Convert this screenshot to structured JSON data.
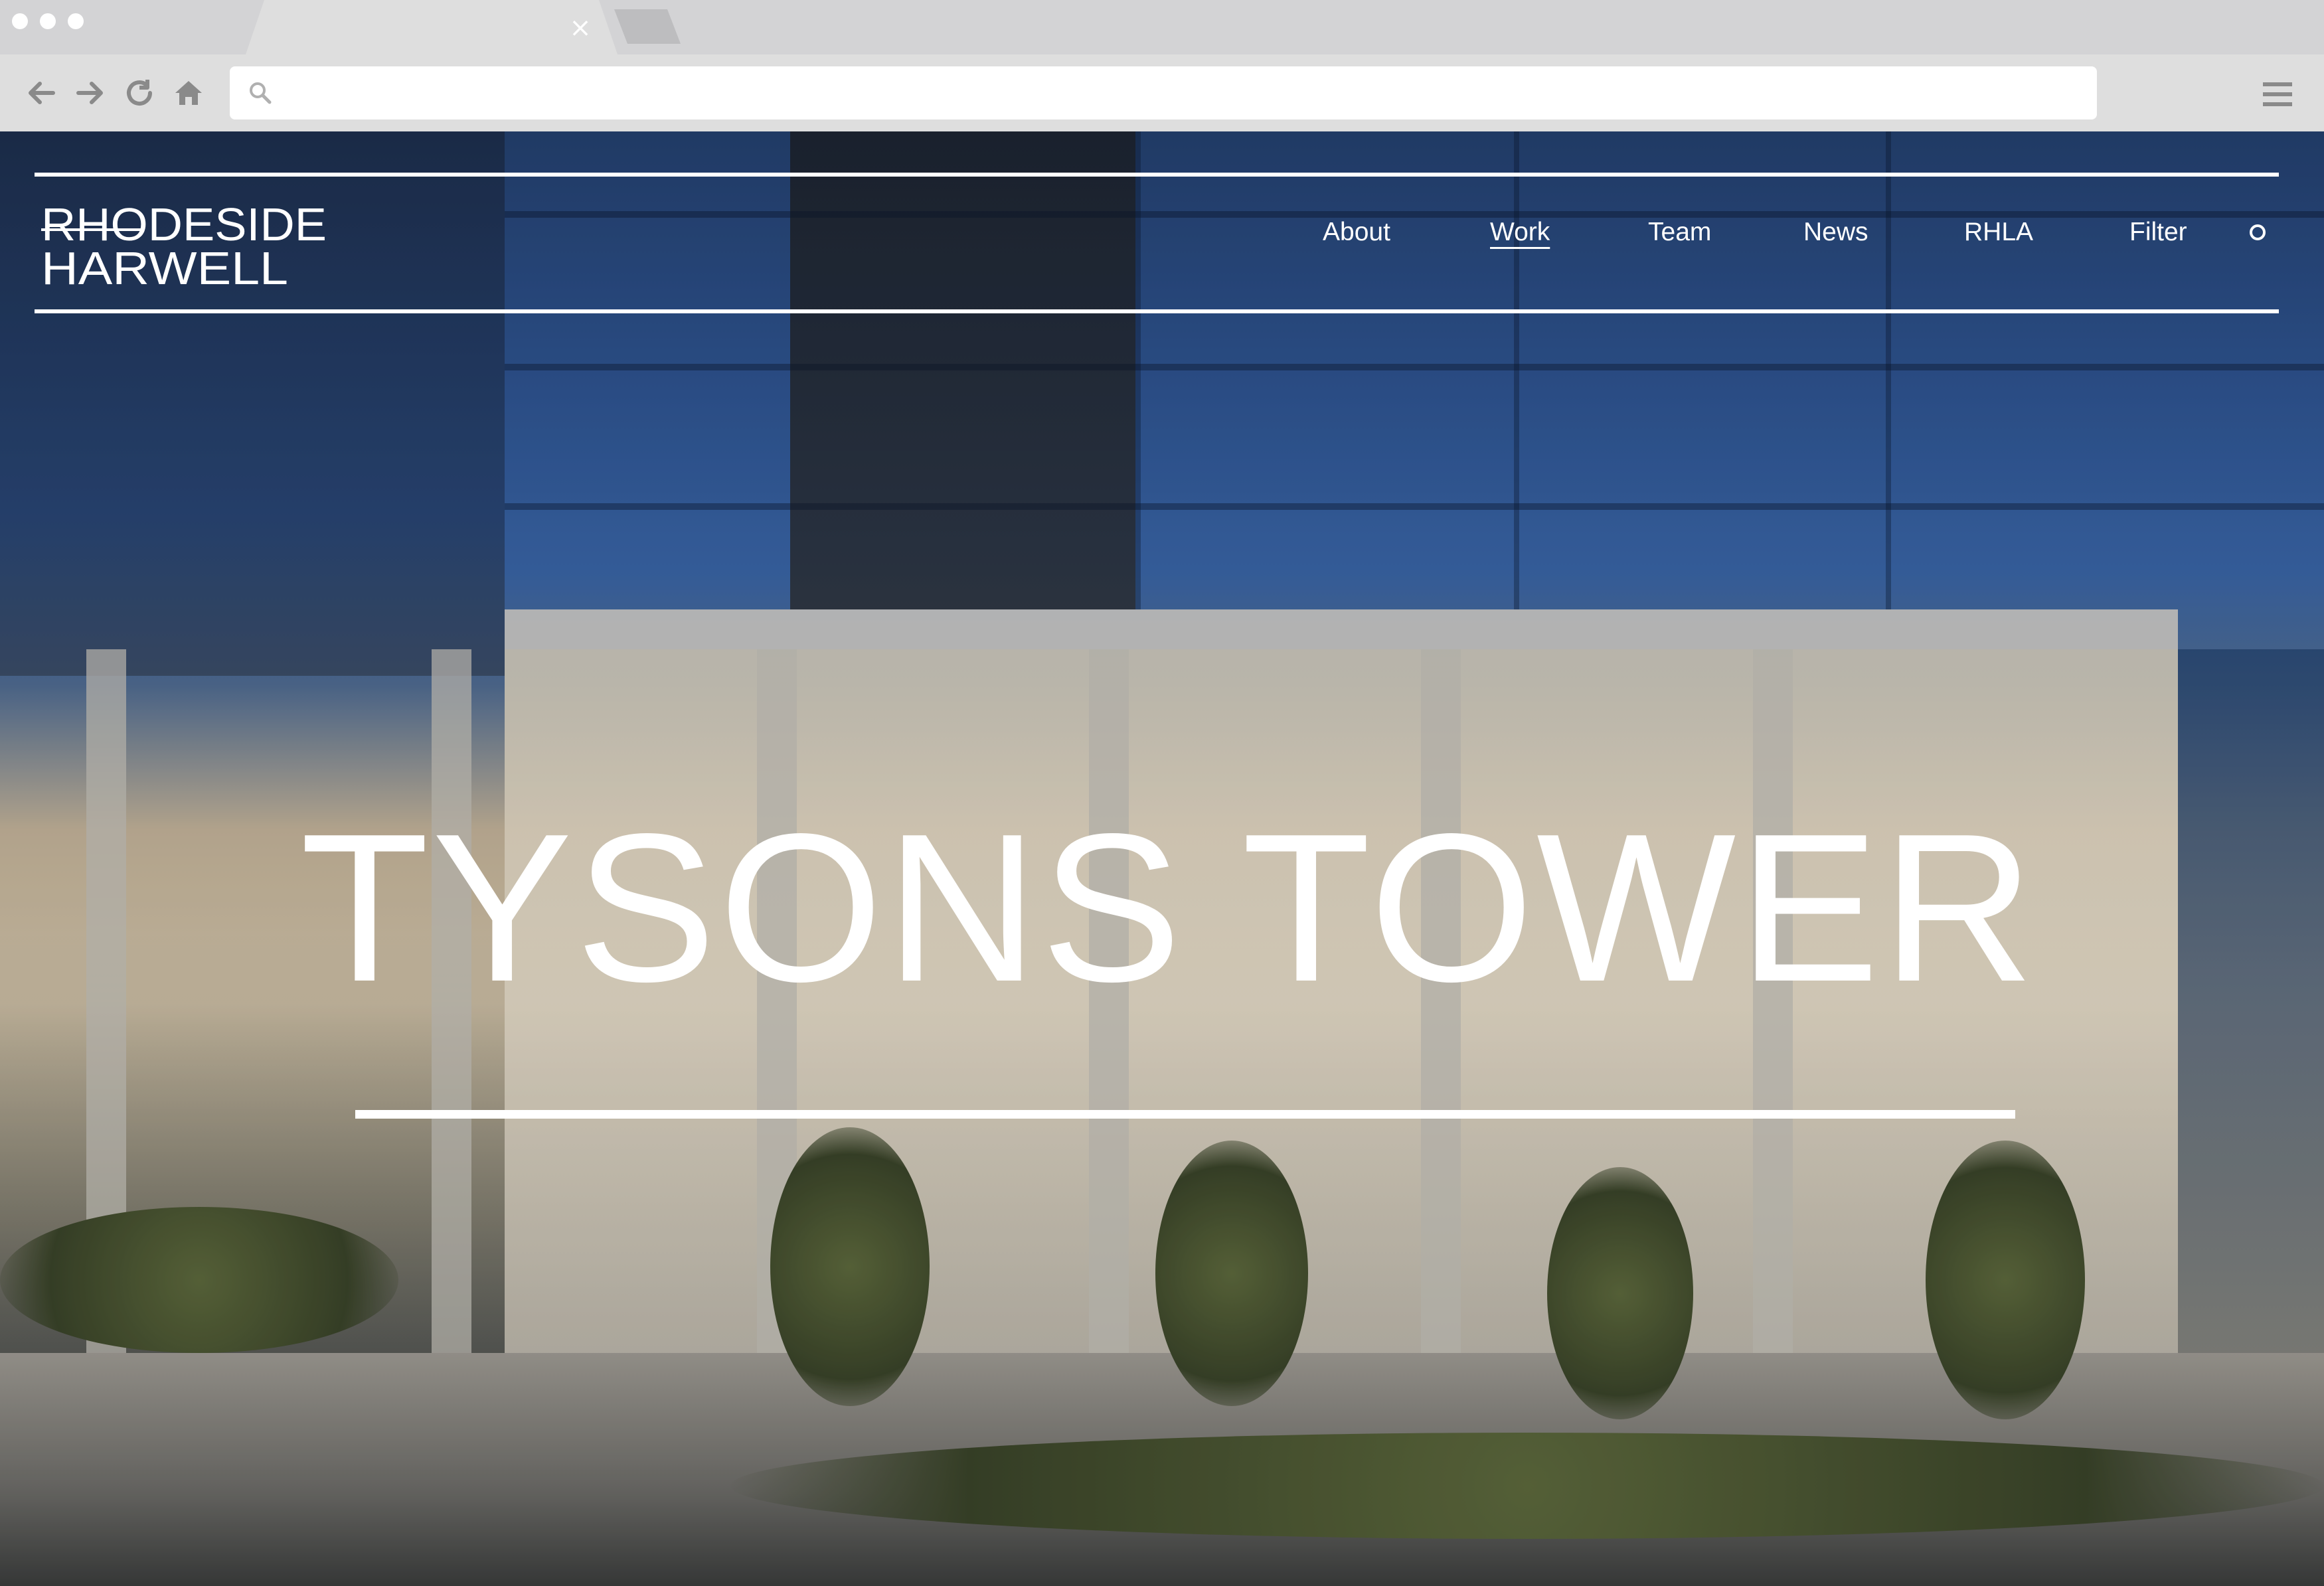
{
  "browser": {
    "url_value": "",
    "url_placeholder": "",
    "tab_close_glyph": "×",
    "icons": [
      "back-arrow-icon",
      "forward-arrow-icon",
      "reload-icon",
      "home-icon",
      "search-icon",
      "hamburger-menu-icon"
    ]
  },
  "site": {
    "logo_text": [
      "RHODESIDE",
      "HARWELL"
    ],
    "nav": [
      {
        "label": "About",
        "active": false
      },
      {
        "label": "Work",
        "active": true
      },
      {
        "label": "Team",
        "active": false
      },
      {
        "label": "News",
        "active": false
      },
      {
        "label": "RHLA",
        "active": false
      },
      {
        "label": "Filter",
        "active": false
      }
    ],
    "search_icon": "circle-search-icon"
  },
  "hero": {
    "title": "TYSONS TOWER"
  },
  "colors": {
    "chrome_bg": "#dedede",
    "tab_strip": "#d3d3d5",
    "header_text": "#ffffff"
  }
}
